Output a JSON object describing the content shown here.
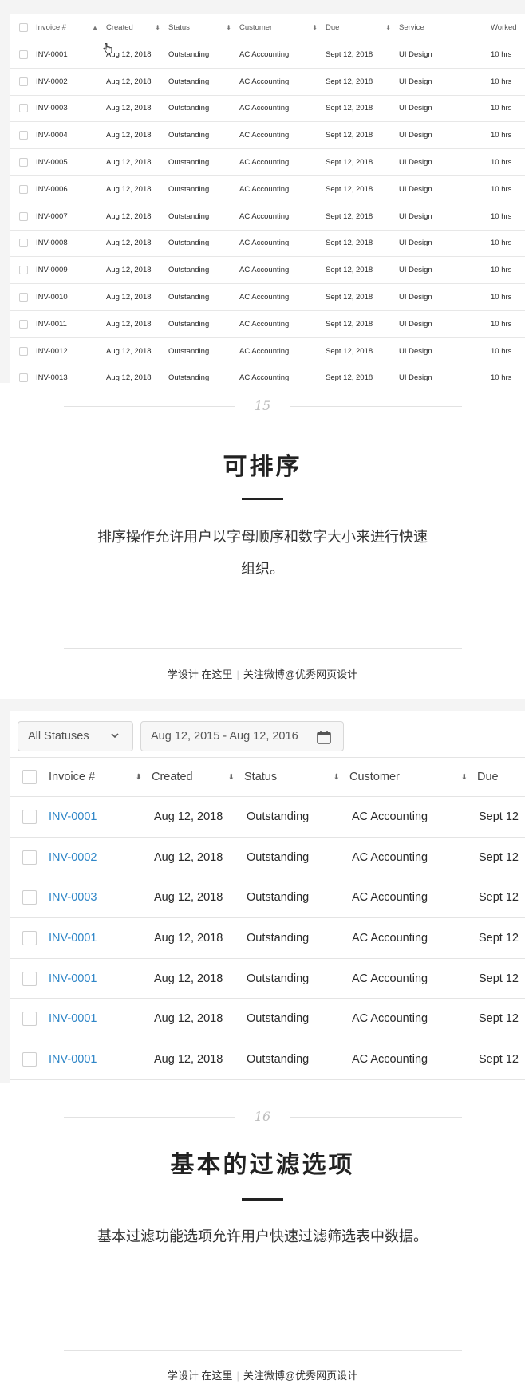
{
  "table1": {
    "columns": [
      "Invoice #",
      "Created",
      "Status",
      "Customer",
      "Due",
      "Service",
      "Worked"
    ],
    "rows": [
      [
        "INV-0001",
        "Aug 12, 2018",
        "Outstanding",
        "AC Accounting",
        "Sept 12, 2018",
        "UI Design",
        "10 hrs"
      ],
      [
        "INV-0002",
        "Aug 12, 2018",
        "Outstanding",
        "AC Accounting",
        "Sept 12, 2018",
        "UI Design",
        "10 hrs"
      ],
      [
        "INV-0003",
        "Aug 12, 2018",
        "Outstanding",
        "AC Accounting",
        "Sept 12, 2018",
        "UI Design",
        "10 hrs"
      ],
      [
        "INV-0004",
        "Aug 12, 2018",
        "Outstanding",
        "AC Accounting",
        "Sept 12, 2018",
        "UI Design",
        "10 hrs"
      ],
      [
        "INV-0005",
        "Aug 12, 2018",
        "Outstanding",
        "AC Accounting",
        "Sept 12, 2018",
        "UI Design",
        "10 hrs"
      ],
      [
        "INV-0006",
        "Aug 12, 2018",
        "Outstanding",
        "AC Accounting",
        "Sept 12, 2018",
        "UI Design",
        "10 hrs"
      ],
      [
        "INV-0007",
        "Aug 12, 2018",
        "Outstanding",
        "AC Accounting",
        "Sept 12, 2018",
        "UI Design",
        "10 hrs"
      ],
      [
        "INV-0008",
        "Aug 12, 2018",
        "Outstanding",
        "AC Accounting",
        "Sept 12, 2018",
        "UI Design",
        "10 hrs"
      ],
      [
        "INV-0009",
        "Aug 12, 2018",
        "Outstanding",
        "AC Accounting",
        "Sept 12, 2018",
        "UI Design",
        "10 hrs"
      ],
      [
        "INV-0010",
        "Aug 12, 2018",
        "Outstanding",
        "AC Accounting",
        "Sept 12, 2018",
        "UI Design",
        "10 hrs"
      ],
      [
        "INV-0011",
        "Aug 12, 2018",
        "Outstanding",
        "AC Accounting",
        "Sept 12, 2018",
        "UI Design",
        "10 hrs"
      ],
      [
        "INV-0012",
        "Aug 12, 2018",
        "Outstanding",
        "AC Accounting",
        "Sept 12, 2018",
        "UI Design",
        "10 hrs"
      ],
      [
        "INV-0013",
        "Aug 12, 2018",
        "Outstanding",
        "AC Accounting",
        "Sept 12, 2018",
        "UI Design",
        "10 hrs"
      ]
    ]
  },
  "section1": {
    "number": "15",
    "title": "可排序",
    "description_line1": "排序操作允许用户以字母顺序和数字大小来进行快速",
    "description_line2": "组织。",
    "footer_left": "学设计 在这里",
    "footer_right": "关注微博@优秀网页设计"
  },
  "filters": {
    "status_select": "All Statuses",
    "date_range": "Aug 12, 2015 - Aug 12, 2016"
  },
  "table2": {
    "columns": [
      "Invoice #",
      "Created",
      "Status",
      "Customer",
      "Due"
    ],
    "rows": [
      [
        "INV-0001",
        "Aug 12, 2018",
        "Outstanding",
        "AC Accounting",
        "Sept 12"
      ],
      [
        "INV-0002",
        "Aug 12, 2018",
        "Outstanding",
        "AC Accounting",
        "Sept 12"
      ],
      [
        "INV-0003",
        "Aug 12, 2018",
        "Outstanding",
        "AC Accounting",
        "Sept 12"
      ],
      [
        "INV-0001",
        "Aug 12, 2018",
        "Outstanding",
        "AC Accounting",
        "Sept 12"
      ],
      [
        "INV-0001",
        "Aug 12, 2018",
        "Outstanding",
        "AC Accounting",
        "Sept 12"
      ],
      [
        "INV-0001",
        "Aug 12, 2018",
        "Outstanding",
        "AC Accounting",
        "Sept 12"
      ],
      [
        "INV-0001",
        "Aug 12, 2018",
        "Outstanding",
        "AC Accounting",
        "Sept 12"
      ]
    ],
    "link_color": "#2f86c7"
  },
  "section2": {
    "number": "16",
    "title": "基本的过滤选项",
    "description": "基本过滤功能选项允许用户快速过滤筛选表中数据。",
    "footer_left": "学设计 在这里",
    "footer_right": "关注微博@优秀网页设计"
  },
  "icons": {
    "sort": "sort-arrows-icon",
    "cursor": "hand-cursor-icon",
    "chevron": "chevron-down-icon",
    "calendar": "calendar-icon"
  }
}
